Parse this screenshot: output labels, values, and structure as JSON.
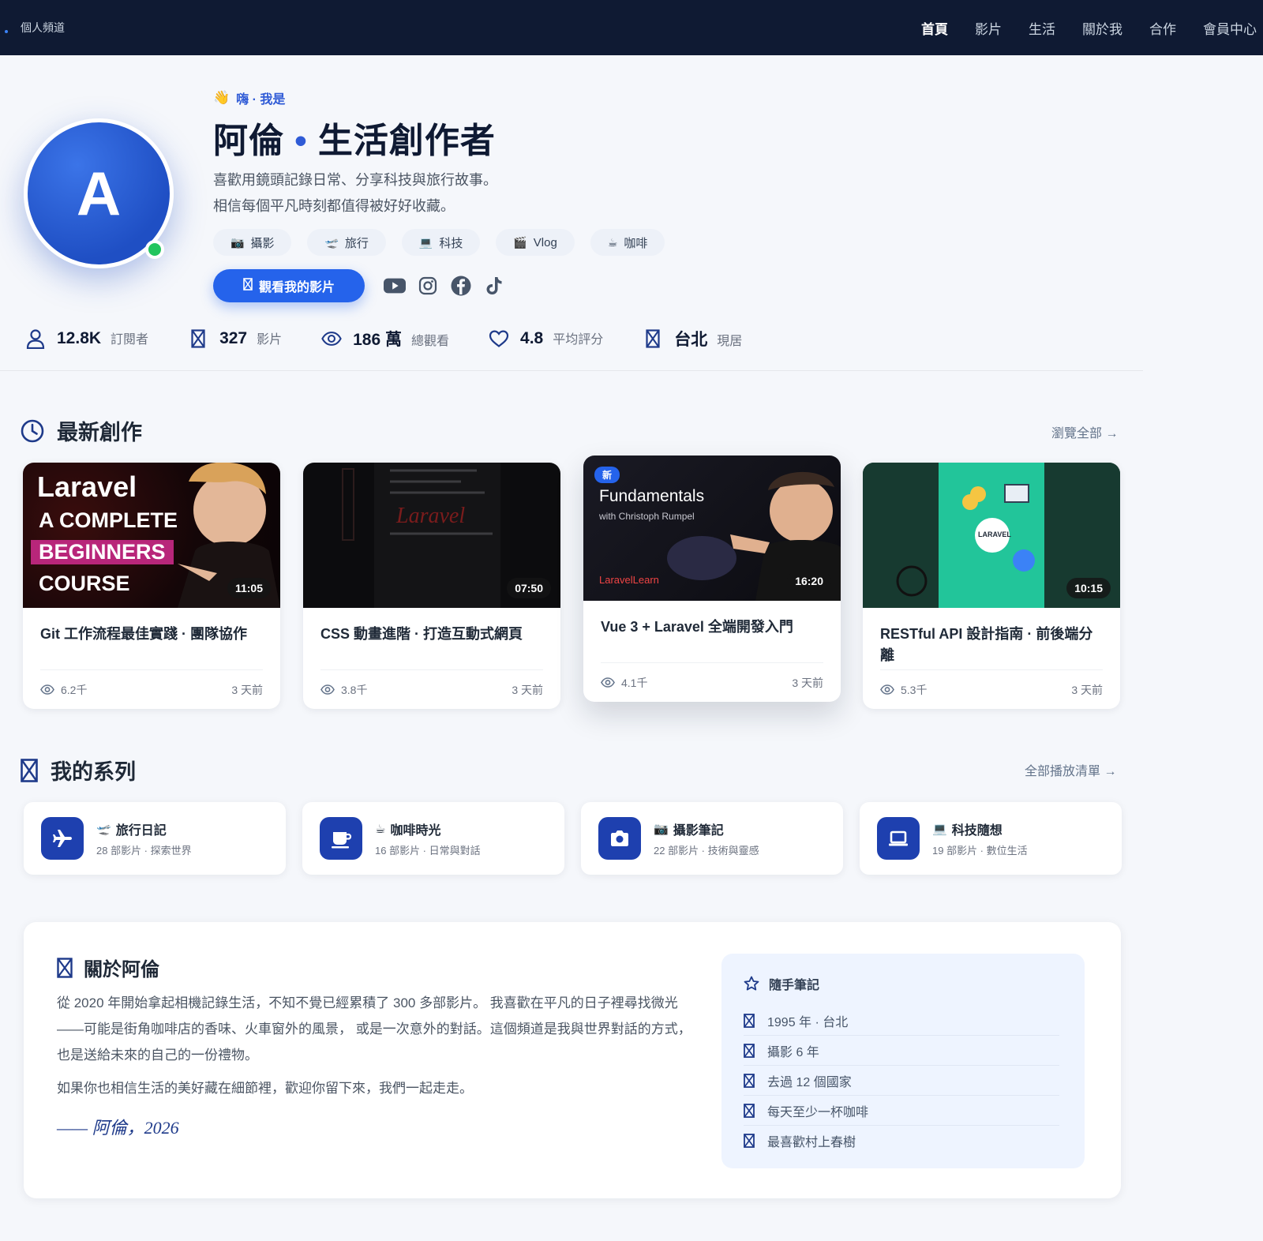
{
  "nav": {
    "brand": "個人頻道",
    "links": [
      "首頁",
      "影片",
      "生活",
      "關於我",
      "合作",
      "會員中心"
    ]
  },
  "profile": {
    "avatar_letter": "A",
    "greeting": "嗨 · 我是",
    "name": "阿倫",
    "separator": "•",
    "role": "生活創作者",
    "bio_lines": [
      "喜歡用鏡頭記錄日常、分享科技與旅行故事。",
      "相信每個平凡時刻都值得被好好收藏。"
    ],
    "tags": [
      {
        "icon": "📷",
        "label": "攝影"
      },
      {
        "icon": "🛫",
        "label": "旅行"
      },
      {
        "icon": "💻",
        "label": "科技"
      },
      {
        "icon": "🎬",
        "label": "Vlog"
      },
      {
        "icon": "☕",
        "label": "咖啡"
      }
    ],
    "watch_button": "觀看我的影片",
    "socials": [
      "youtube-icon",
      "instagram-icon",
      "facebook-icon",
      "tiktok-icon"
    ]
  },
  "stats": [
    {
      "icon": "user-icon",
      "value": "12.8K",
      "label": "訂閱者"
    },
    {
      "icon": "video-icon",
      "value": "327",
      "label": "影片"
    },
    {
      "icon": "eye-icon",
      "value": "186 萬",
      "label": "總觀看"
    },
    {
      "icon": "heart-icon",
      "value": "4.8",
      "label": "平均評分"
    },
    {
      "icon": "location-icon",
      "value": "台北",
      "label": "現居"
    }
  ],
  "latest": {
    "title": "最新創作",
    "link": "瀏覽全部 →",
    "videos": [
      {
        "title": "Git 工作流程最佳實踐 · 團隊協作",
        "duration": "11:05",
        "views": "6.2千",
        "age": "3 天前",
        "thumb_lines": [
          "Laravel",
          "A COMPLETE",
          "BEGINNERS",
          "COURSE"
        ]
      },
      {
        "title": "CSS 動畫進階 · 打造互動式網頁",
        "duration": "07:50",
        "views": "3.8千",
        "age": "3 天前",
        "thumb_lines": [
          "Laravel"
        ]
      },
      {
        "title": "Vue 3 + Laravel 全端開發入門",
        "duration": "16:20",
        "views": "4.1千",
        "age": "3 天前",
        "badge": "新",
        "thumb_lines": [
          "Fundamentals",
          "with Christoph Rumpel",
          "LaravelLearn"
        ]
      },
      {
        "title": "RESTful API 設計指南 · 前後端分離",
        "duration": "10:15",
        "views": "5.3千",
        "age": "3 天前",
        "thumb_lines": [
          "LARAVEL"
        ]
      }
    ]
  },
  "series": {
    "title": "我的系列",
    "link": "全部播放清單 →",
    "items": [
      {
        "emoji": "🛫",
        "icon": "airplane-icon",
        "title": "旅行日記",
        "sub": "28 部影片 · 探索世界"
      },
      {
        "emoji": "☕",
        "icon": "coffee-icon",
        "title": "咖啡時光",
        "sub": "16 部影片 · 日常與對話"
      },
      {
        "emoji": "📷",
        "icon": "camera-icon",
        "title": "攝影筆記",
        "sub": "22 部影片 · 技術與靈感"
      },
      {
        "emoji": "💻",
        "icon": "laptop-icon",
        "title": "科技隨想",
        "sub": "19 部影片 · 數位生活"
      }
    ]
  },
  "about": {
    "title": "關於阿倫",
    "p1": "從 2020 年開始拿起相機記錄生活，不知不覺已經累積了 300 多部影片。 我喜歡在平凡的日子裡尋找微光——可能是街角咖啡店的香味、火車窗外的風景， 或是一次意外的對話。這個頻道是我與世界對話的方式，也是送給未來的自己的一份禮物。",
    "p2": "如果你也相信生活的美好藏在細節裡，歡迎你留下來，我們一起走走。",
    "signature": "—— 阿倫，2026",
    "notes_title": "隨手筆記",
    "notes": [
      "1995 年 · 台北",
      "攝影 6 年",
      "去過 12 個國家",
      "每天至少一杯咖啡",
      "最喜歡村上春樹"
    ]
  },
  "colors": {
    "nav_bg": "#0f1a33",
    "accent": "#2563eb",
    "series_icon_bg": "#1e40af",
    "online": "#22c55e"
  }
}
